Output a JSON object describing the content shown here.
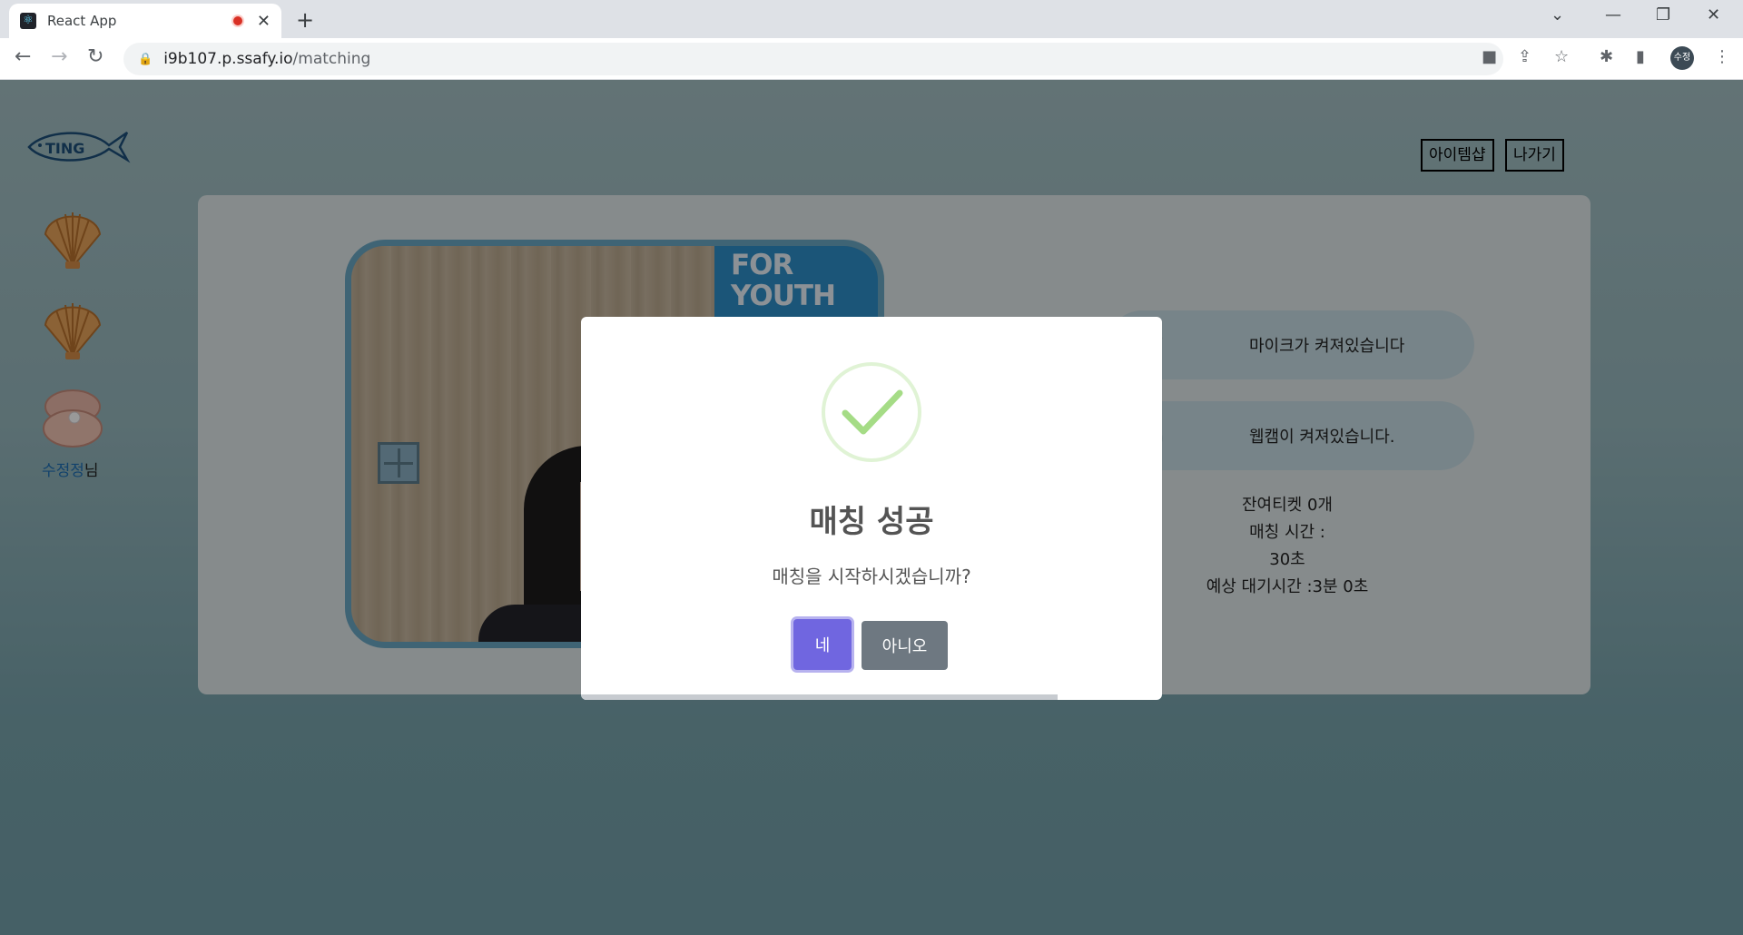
{
  "browser": {
    "tab_title": "React App",
    "tab_favicon": "react-icon",
    "url_host": "i9b107.p.ssafy.io",
    "url_path": "/matching",
    "profile_label": "수정"
  },
  "app": {
    "header": {
      "item_shop": "아이템샵",
      "exit": "나가기"
    },
    "user": {
      "name": "수정정",
      "suffix": "님"
    },
    "status": {
      "mic": "마이크가 켜져있습니다",
      "webcam": "웹캠이 켜져있습니다."
    },
    "info": {
      "tickets": "잔여티켓 0개",
      "match_time_label": "매칭 시간 :",
      "match_time_value": "30초",
      "expected_wait": "예상 대기시간 :3분 0초"
    },
    "video": {
      "poster_line1": "FOR",
      "poster_line2": "YOUTH"
    }
  },
  "modal": {
    "icon": "success-check-icon",
    "title": "매칭 성공",
    "text": "매칭을 시작하시겠습니까?",
    "confirm_label": "네",
    "cancel_label": "아니오",
    "timer_remaining": 0.82,
    "colors": {
      "confirm": "#7066e0",
      "cancel": "#6e7881",
      "check": "#a5dc86"
    }
  }
}
